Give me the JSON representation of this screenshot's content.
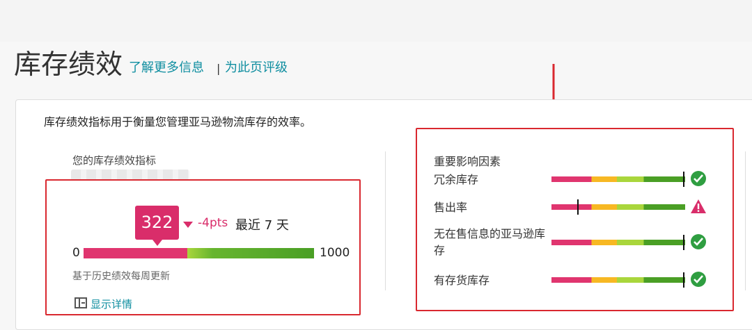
{
  "header": {
    "title": "库存绩效",
    "learn_more": "了解更多信息",
    "separator": "|",
    "rate_page": "为此页评级"
  },
  "intro": "库存绩效指标用于衡量您管理亚马逊物流库存的效率。",
  "ipi": {
    "heading": "您的库存绩效指标",
    "score": "322",
    "delta": "-4pts",
    "period": "最近 7 天",
    "scale_min": "0",
    "scale_max": "1000",
    "score_fraction": 0.322,
    "footnote": "基于历史绩效每周更新",
    "show_details": "显示详情"
  },
  "factors": {
    "title": "重要影响因素",
    "items": [
      {
        "label": "冗余库存",
        "marker_fraction": 0.99,
        "status": "ok",
        "status_icon": "check-circle-icon"
      },
      {
        "label": "售出率",
        "marker_fraction": 0.2,
        "status": "warning",
        "status_icon": "warning-triangle-icon"
      },
      {
        "label": "无在售信息的亚马逊库存",
        "marker_fraction": 0.99,
        "status": "ok",
        "status_icon": "check-circle-icon"
      },
      {
        "label": "有存货库存",
        "marker_fraction": 0.99,
        "status": "ok",
        "status_icon": "check-circle-icon"
      }
    ]
  },
  "colors": {
    "link": "#0f8ea0",
    "score_badge": "#d92d6a",
    "ok_green": "#2f9e41",
    "warning_red": "#d92d6a",
    "annotation_red": "#d9282f"
  }
}
